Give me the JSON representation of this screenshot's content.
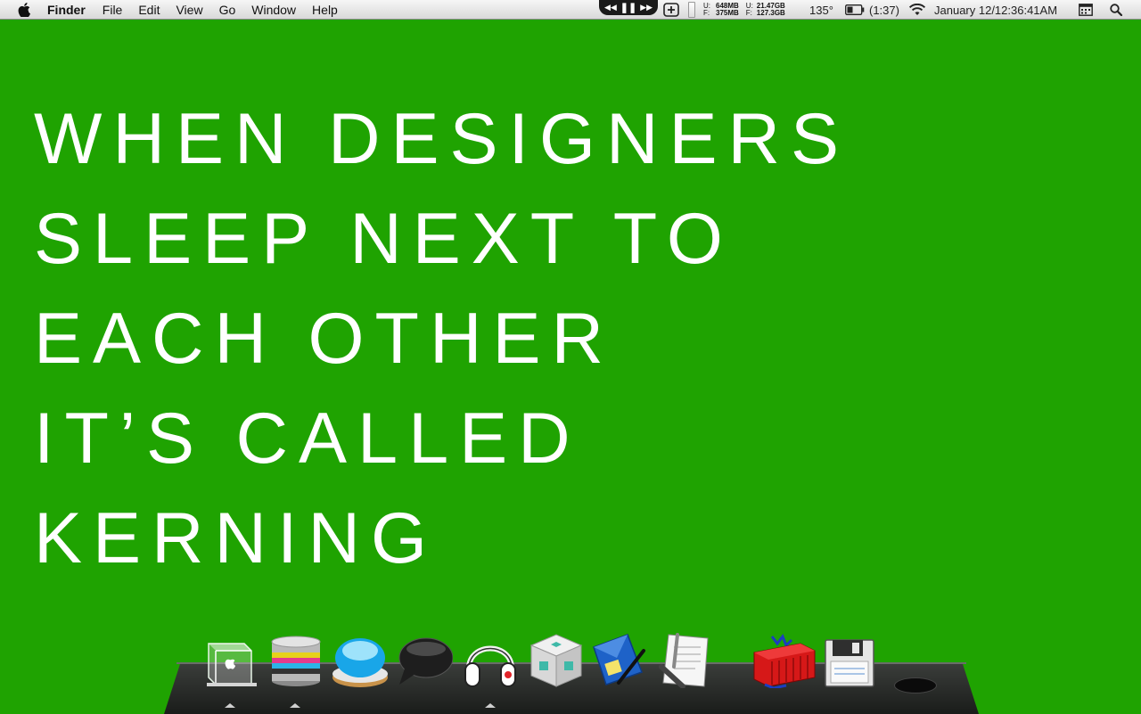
{
  "menubar": {
    "app_name": "Finder",
    "items": [
      "File",
      "Edit",
      "View",
      "Go",
      "Window",
      "Help"
    ],
    "memory": {
      "used_label": "U:",
      "used": "648MB",
      "free_label": "F:",
      "free": "375MB"
    },
    "disk": {
      "used_label": "U:",
      "used": "21.47GB",
      "free_label": "F:",
      "free": "127.3GB"
    },
    "temperature": "135°",
    "battery_time": "(1:37)",
    "clock": "January 12/12:36:41AM"
  },
  "wallpaper": {
    "lines": [
      "WHEN DESIGNERS",
      "SLEEP NEXT TO",
      "EACH OTHER",
      "IT’S CALLED",
      "KERNING"
    ]
  },
  "dock": {
    "icons": [
      "finder-cube-icon",
      "database-stack-icon",
      "blue-button-icon",
      "speech-bubble-icon",
      "headphones-icon",
      "menger-cube-icon",
      "mail-icon",
      "textedit-pen-icon",
      "shipping-container-icon",
      "floppy-disk-icon",
      "trash-icon"
    ]
  }
}
